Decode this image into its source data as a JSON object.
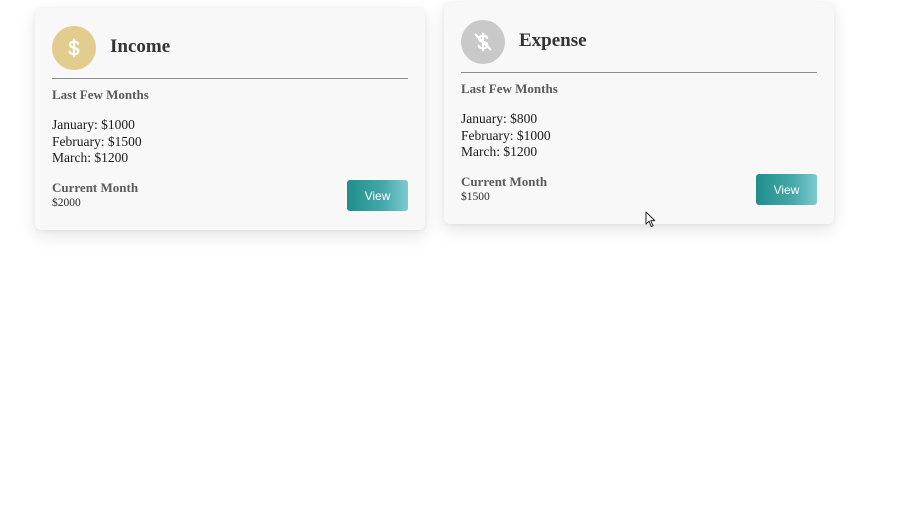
{
  "cards": [
    {
      "title": "Income",
      "icon": "dollar-icon",
      "icon_color": "#e2cc8e",
      "section_title": "Last Few Months",
      "months": [
        "January: $1000",
        "February: $1500",
        "March: $1200"
      ],
      "current_label": "Current Month",
      "current_value": "$2000",
      "button_label": "View"
    },
    {
      "title": "Expense",
      "icon": "dollar-off-icon",
      "icon_color": "#c9c9c9",
      "section_title": "Last Few Months",
      "months": [
        "January: $800",
        "February: $1000",
        "March: $1200"
      ],
      "current_label": "Current Month",
      "current_value": "$1500",
      "button_label": "View"
    }
  ],
  "colors": {
    "button_gradient_start": "#1f8f8c",
    "button_gradient_end": "#7ccbcf",
    "card_background": "#f8f8f8"
  }
}
